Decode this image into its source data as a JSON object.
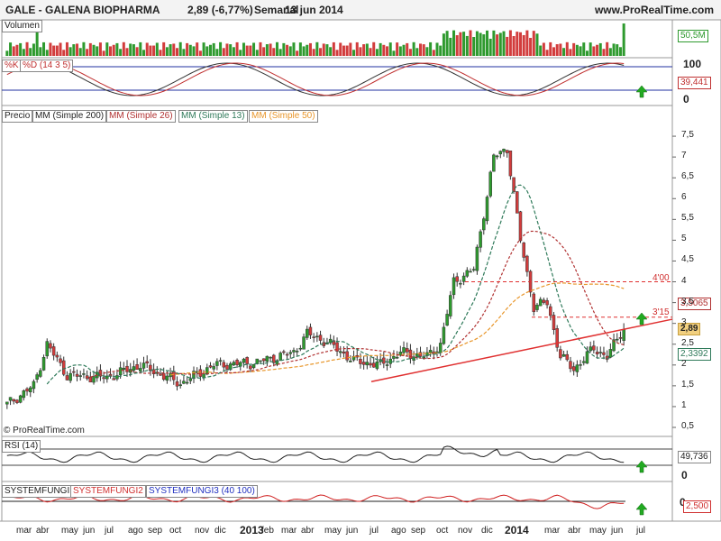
{
  "header": {
    "symbol": "GALE - GALENA BIOPHARMA",
    "quote": "2,89 (-6,77%)",
    "period": "Semanal",
    "date": "13 jun 2014",
    "site": "www.ProRealTime.com"
  },
  "panels": {
    "volume": {
      "title": "Volumen",
      "value": "50,5M"
    },
    "stoch": {
      "k_label": "%K",
      "d_label": "%D (14 3 5)",
      "axis_top": "100",
      "axis_bottom": "0",
      "value": "39,441"
    },
    "price": {
      "title": "Precio",
      "mm200": "MM (Simple 200)",
      "mm26": "MM (Simple 26)",
      "mm13": "MM (Simple 13)",
      "mm50": "MM (Simple 50)",
      "copyright": "© ProRealTime.com",
      "last": "2,89",
      "box_3506": "3,5065",
      "box_2339": "2,3392",
      "line_400": "4'00",
      "line_315": "3'15"
    },
    "rsi": {
      "title": "RSI (14)",
      "value": "49,736",
      "axis_bottom": "0"
    },
    "systemfungi": {
      "t1": "SYSTEMFUNGI",
      "t2": "SYSTEMFUNGI2",
      "t3": "SYSTEMFUNGI3 (40 100)",
      "axis_zero": "0",
      "value": "2,500"
    }
  },
  "colors": {
    "up": "#2e9a2e",
    "down": "#d23c3c",
    "mm26": "#b03030",
    "mm13": "#2f7a5a",
    "mm50": "#e8962a",
    "trend": "#e03030",
    "arrow": "#22aa22"
  },
  "chart_data": {
    "type": "candlestick",
    "ylim": [
      0.5,
      8
    ],
    "y_ticks": [
      "0,5",
      "1",
      "1,5",
      "2",
      "2,5",
      "3",
      "3,5",
      "4",
      "4,5",
      "5",
      "5,5",
      "6",
      "6,5",
      "7",
      "7,5"
    ],
    "x_ticks": [
      "mar",
      "abr",
      "may",
      "jun",
      "jul",
      "ago",
      "sep",
      "oct",
      "nov",
      "dic",
      "2013",
      "feb",
      "mar",
      "abr",
      "may",
      "jun",
      "jul",
      "ago",
      "sep",
      "oct",
      "nov",
      "dic",
      "2014",
      "mar",
      "abr",
      "may",
      "jun",
      "jul"
    ],
    "last_price": 2.89,
    "levels": [
      {
        "label": "4'00",
        "value": 4.0
      },
      {
        "label": "3'15",
        "value": 3.15
      }
    ]
  }
}
